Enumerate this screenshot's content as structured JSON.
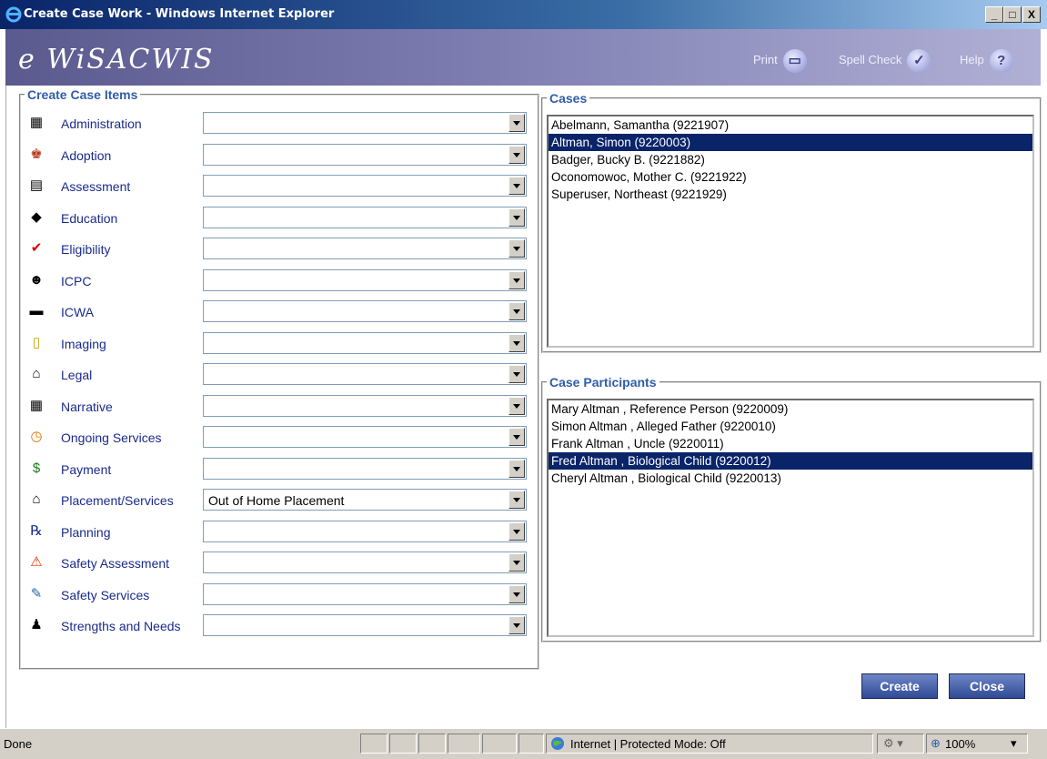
{
  "window": {
    "title": "Create Case Work - Windows Internet Explorer",
    "min": "_",
    "max": "□",
    "close": "X"
  },
  "header": {
    "logo": "e WiSACWIS",
    "print": "Print",
    "spell_check": "Spell Check",
    "help": "Help",
    "help_glyph": "?"
  },
  "create_items": {
    "legend": "Create Case Items",
    "rows": [
      {
        "label": "Administration",
        "icon": "building-icon",
        "value": ""
      },
      {
        "label": "Adoption",
        "icon": "adoption-icon",
        "value": ""
      },
      {
        "label": "Assessment",
        "icon": "clipboard-icon",
        "value": ""
      },
      {
        "label": "Education",
        "icon": "graduation-cap-icon",
        "value": ""
      },
      {
        "label": "Eligibility",
        "icon": "checkmark-icon",
        "value": ""
      },
      {
        "label": "ICPC",
        "icon": "people-icon",
        "value": ""
      },
      {
        "label": "ICWA",
        "icon": "feather-icon",
        "value": ""
      },
      {
        "label": "Imaging",
        "icon": "image-icon",
        "value": ""
      },
      {
        "label": "Legal",
        "icon": "courthouse-icon",
        "value": ""
      },
      {
        "label": "Narrative",
        "icon": "document-icon",
        "value": ""
      },
      {
        "label": "Ongoing Services",
        "icon": "clock-icon",
        "value": ""
      },
      {
        "label": "Payment",
        "icon": "dollar-icon",
        "value": ""
      },
      {
        "label": "Placement/Services",
        "icon": "house-icon",
        "value": "Out of Home Placement"
      },
      {
        "label": "Planning",
        "icon": "rx-icon",
        "value": ""
      },
      {
        "label": "Safety Assessment",
        "icon": "warning-icon",
        "value": ""
      },
      {
        "label": "Safety Services",
        "icon": "pencil-icon",
        "value": ""
      },
      {
        "label": "Strengths and Needs",
        "icon": "strengths-icon",
        "value": ""
      }
    ]
  },
  "cases": {
    "legend": "Cases",
    "items": [
      "Abelmann, Samantha (9221907)",
      "Altman, Simon (9220003)",
      "Badger, Bucky B. (9221882)",
      "Oconomowoc, Mother C. (9221922)",
      "Superuser, Northeast (9221929)"
    ],
    "selected_index": 1
  },
  "participants": {
    "legend": "Case Participants",
    "items": [
      "Mary Altman , Reference Person (9220009)",
      "Simon Altman , Alleged Father (9220010)",
      "Frank Altman , Uncle (9220011)",
      "Fred Altman , Biological Child (9220012)",
      "Cheryl Altman , Biological Child (9220013)"
    ],
    "selected_index": 3
  },
  "buttons": {
    "create": "Create",
    "close": "Close"
  },
  "status": {
    "left": "Done",
    "zone": "Internet | Protected Mode: Off",
    "zoom": "100%"
  },
  "colors": {
    "selection": "#0a246a",
    "label": "#1a2a8c",
    "legend": "#2f5da8"
  }
}
